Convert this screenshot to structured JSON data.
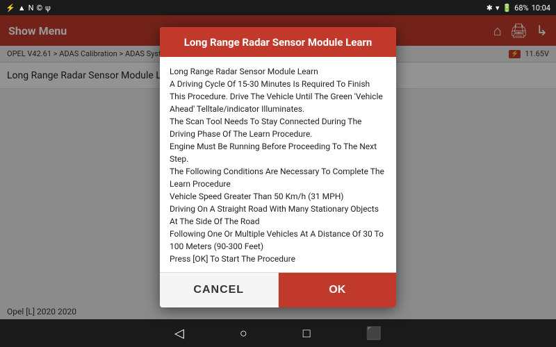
{
  "statusBar": {
    "leftIcons": [
      "bluetooth",
      "wifi",
      "N",
      "location",
      "signal"
    ],
    "battery": "68%",
    "time": "10:04"
  },
  "toolbar": {
    "title": "Show Menu",
    "homeIcon": "🏠",
    "printIcon": "🖨",
    "shareIcon": "📤"
  },
  "breadcrumb": {
    "text": "OPEL V42.61 > ADAS Calibration > ADAS Syste...",
    "voltage": "11.65V"
  },
  "pageTitle": {
    "text": "Long Range Radar Sensor Module L..."
  },
  "modal": {
    "title": "Long Range Radar Sensor Module Learn",
    "body": "Long Range Radar Sensor Module Learn\nA Driving Cycle Of 15-30 Minutes Is Required To Finish This Procedure. Drive The Vehicle Until The Green 'Vehicle Ahead' Telltale/indicator Illuminates.\nThe Scan Tool Needs To Stay Connected During The Driving Phase Of The Learn Procedure.\nEngine Must Be Running Before Proceeding To The Next Step.\nThe Following Conditions Are Necessary To Complete The Learn Procedure\nVehicle Speed Greater Than 50 Km/h (31 MPH)\nDriving On A Straight Road With Many Stationary Objects At The Side Of The Road\nFollowing One Or Multiple Vehicles At A Distance Of 30 To 100 Meters (90-300 Feet)\nPress [OK] To Start The Procedure",
    "cancelLabel": "CANCEL",
    "okLabel": "OK"
  },
  "bottomLabel": {
    "text": "Opel [L] 2020 2020"
  },
  "bottomNav": {
    "backIcon": "◁",
    "homeIcon": "○",
    "squareIcon": "□",
    "recentIcon": "⬛"
  }
}
